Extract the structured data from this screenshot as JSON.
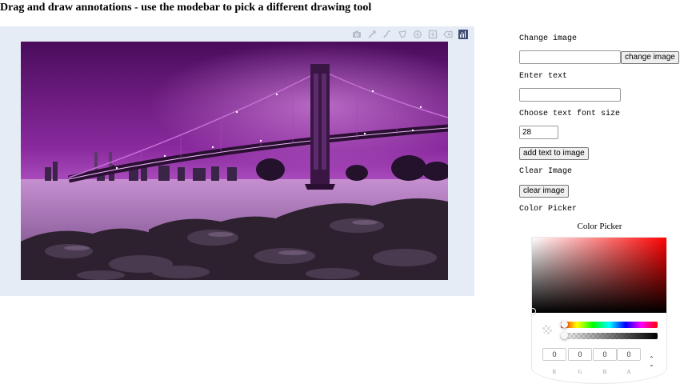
{
  "page": {
    "title": "Drag and draw annotations - use the modebar to pick a different drawing tool"
  },
  "modebar": {
    "tools": [
      "camera-icon",
      "draw-line-icon",
      "draw-freehand-icon",
      "draw-closed-path-icon",
      "draw-circle-icon",
      "draw-rectangle-icon",
      "erase-shape-icon",
      "plotly-logo"
    ]
  },
  "controls": {
    "change_image_label": "Change image",
    "change_image_value": "",
    "change_image_button": "change image",
    "enter_text_label": "Enter text",
    "enter_text_value": "",
    "font_size_label": "Choose text font size",
    "font_size_value": "28",
    "add_text_button": "add text to image",
    "clear_image_label": "Clear Image",
    "clear_image_button": "clear image",
    "color_picker_label": "Color Picker"
  },
  "color_picker": {
    "title": "Color Picker",
    "hue_color": "#ff0000",
    "fields": [
      {
        "label": "R",
        "value": "0"
      },
      {
        "label": "G",
        "value": "0"
      },
      {
        "label": "B",
        "value": "0"
      },
      {
        "label": "A",
        "value": "0"
      }
    ]
  },
  "colors": {
    "graph_background": "#e5ecf6",
    "modebar_icon": "#b4bdcb",
    "plotly_logo": "#3f4f75"
  }
}
